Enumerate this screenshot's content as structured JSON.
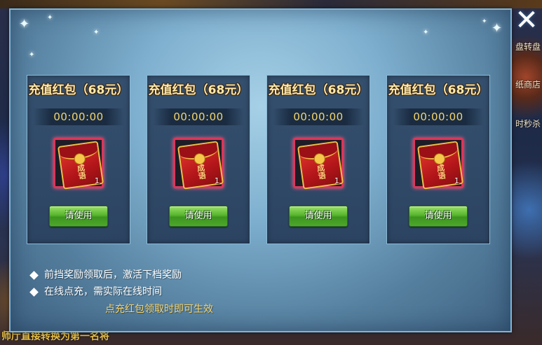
{
  "background": {
    "bottom_text": "师厅直接转换为第一名将",
    "right_labels": [
      "盘转盘",
      "纸商店",
      "时秒杀"
    ]
  },
  "dialog": {
    "close_icon": "close-icon",
    "cards": [
      {
        "title": "充值红包（68元）",
        "timer": "00:00:00",
        "item_count": "1",
        "item_icon": "red-envelope-icon",
        "envelope_text": "成语",
        "button": "请使用"
      },
      {
        "title": "充值红包（68元）",
        "timer": "00:00:00",
        "item_count": "1",
        "item_icon": "red-envelope-icon",
        "envelope_text": "成语",
        "button": "请使用"
      },
      {
        "title": "充值红包（68元）",
        "timer": "00:00:00",
        "item_count": "1",
        "item_icon": "red-envelope-icon",
        "envelope_text": "成语",
        "button": "请使用"
      },
      {
        "title": "充值红包（68元）",
        "timer": "00:00:00",
        "item_count": "1",
        "item_icon": "red-envelope-icon",
        "envelope_text": "成语",
        "button": "请使用"
      }
    ],
    "notes": [
      "前挡奖励领取后，激活下档奖励",
      "在线点充，需实际在线时间"
    ],
    "highlight_note": "点充红包领取时即可生效"
  },
  "colors": {
    "panel_border": "#7fb6d8",
    "title_gold": "#ffe9a8",
    "timer_gold": "#f5d56a",
    "button_green": "#56b52c",
    "item_border": "#d9375a"
  }
}
